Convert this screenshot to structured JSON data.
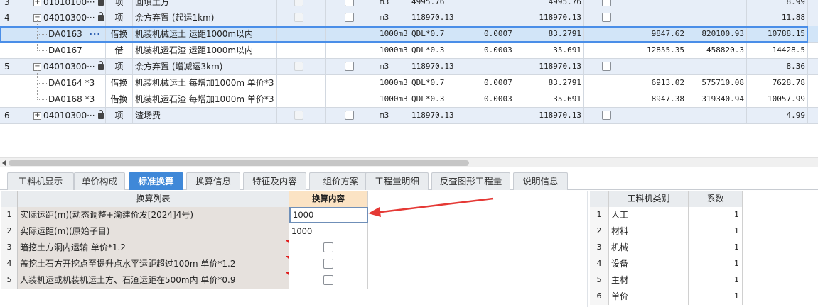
{
  "top_grid": {
    "rows": [
      {
        "idx": "3",
        "code": "01010100···",
        "type": "项",
        "name": "回填土方",
        "unit": "m3",
        "qexp": "4995.76",
        "content": "",
        "qty": "4995.76",
        "unit_price": "",
        "total": "",
        "last": "8.99"
      },
      {
        "idx": "4",
        "code": "04010300···",
        "type": "项",
        "name": "余方弃置 (起运1km)",
        "unit": "m3",
        "qexp": "118970.13",
        "content": "",
        "qty": "118970.13",
        "unit_price": "",
        "total": "",
        "last": "11.88"
      },
      {
        "idx": "",
        "code": "DA0163",
        "type": "借换",
        "name": "机装机械运土 运距1000m以内",
        "unit": "1000m3",
        "qexp": "QDL*0.7",
        "content": "0.0007",
        "qty": "83.2791",
        "unit_price": "9847.62",
        "total": "820100.93",
        "last": "10788.15"
      },
      {
        "idx": "",
        "code": "DA0167",
        "type": "借",
        "name": "机装机运石渣 运距1000m以内",
        "unit": "1000m3",
        "qexp": "QDL*0.3",
        "content": "0.0003",
        "qty": "35.691",
        "unit_price": "12855.35",
        "total": "458820.3",
        "last": "14428.5"
      },
      {
        "idx": "5",
        "code": "04010300···",
        "type": "项",
        "name": "余方弃置 (增减运3km)",
        "unit": "m3",
        "qexp": "118970.13",
        "content": "",
        "qty": "118970.13",
        "unit_price": "",
        "total": "",
        "last": "8.36"
      },
      {
        "idx": "",
        "code": "DA0164 *3",
        "type": "借换",
        "name": "机装机械运土 每增加1000m  单价*3",
        "unit": "1000m3",
        "qexp": "QDL*0.7",
        "content": "0.0007",
        "qty": "83.2791",
        "unit_price": "6913.02",
        "total": "575710.08",
        "last": "7628.78"
      },
      {
        "idx": "",
        "code": "DA0168 *3",
        "type": "借换",
        "name": "机装机运石渣 每增加1000m  单价*3",
        "unit": "1000m3",
        "qexp": "QDL*0.3",
        "content": "0.0003",
        "qty": "35.691",
        "unit_price": "8947.38",
        "total": "319340.94",
        "last": "10057.99"
      },
      {
        "idx": "6",
        "code": "04010300···",
        "type": "项",
        "name": "渣场费",
        "unit": "m3",
        "qexp": "118970.13",
        "content": "",
        "qty": "118970.13",
        "unit_price": "",
        "total": "",
        "last": "4.99"
      }
    ],
    "selected_more": "···"
  },
  "tabs": [
    "工料机显示",
    "单价构成",
    "标准换算",
    "换算信息",
    "特征及内容",
    "组价方案",
    "工程量明细",
    "反查图形工程量",
    "说明信息"
  ],
  "active_tab": "标准换算",
  "conversion": {
    "header_list": "换算列表",
    "header_content": "换算内容",
    "rows": [
      {
        "idx": "1",
        "name": "实际运距(m)(动态调整+渝建价发[2024]4号)",
        "value": "1000"
      },
      {
        "idx": "2",
        "name": "实际运距(m)(原始子目)",
        "value": "1000"
      },
      {
        "idx": "3",
        "name": "暗挖土方洞内运输 单价*1.2",
        "value": ""
      },
      {
        "idx": "4",
        "name": "盖挖土石方开挖点至提升点水平运距超过100m 单价*1.2",
        "value": ""
      },
      {
        "idx": "5",
        "name": "人装机运或机装机运土方、石渣运距在500m内 单价*0.9",
        "value": ""
      }
    ]
  },
  "factors": {
    "header_category": "工料机类别",
    "header_coef": "系数",
    "rows": [
      {
        "idx": "1",
        "category": "人工",
        "coef": "1"
      },
      {
        "idx": "2",
        "category": "材料",
        "coef": "1"
      },
      {
        "idx": "3",
        "category": "机械",
        "coef": "1"
      },
      {
        "idx": "4",
        "category": "设备",
        "coef": "1"
      },
      {
        "idx": "5",
        "category": "主材",
        "coef": "1"
      },
      {
        "idx": "6",
        "category": "单价",
        "coef": "1"
      }
    ]
  },
  "colors": {
    "accent": "#3f88d8",
    "arrow": "#e53935",
    "row_blue": "#e7eef8",
    "header_orange": "#fbe3c4"
  }
}
